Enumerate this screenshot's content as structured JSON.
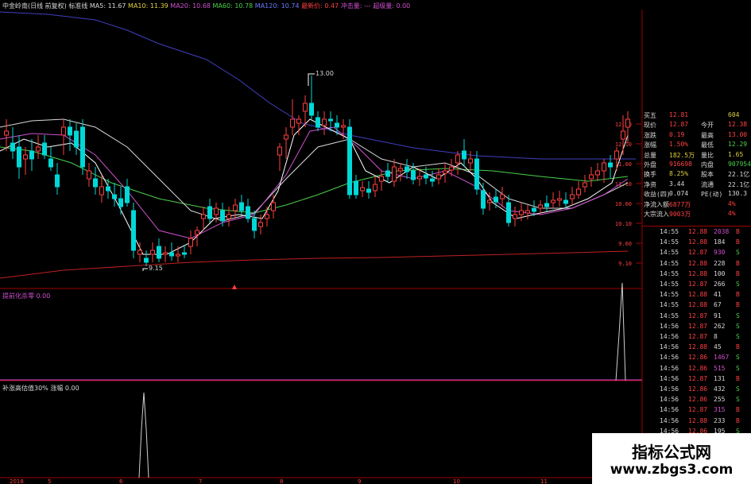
{
  "header": {
    "stock_name": "中金岭南(日线 前复权)",
    "indicator_tag": "标准线",
    "ma5": "MA5: 11.67",
    "ma10": "MA10: 11.39",
    "ma20": "MA20: 10.68",
    "ma60": "MA60: 10.78",
    "ma120": "MA120: 10.74",
    "extra1": "最新价: 0.47",
    "extra2": "冲击量: ---",
    "extra3": "超级量: 0.00"
  },
  "price_labels": {
    "peak": "13.00",
    "low": "9.15"
  },
  "y_axis_ticks": [
    "12.60",
    "12.10",
    "11.60",
    "11.10",
    "10.60",
    "10.10",
    "9.60",
    "9.10"
  ],
  "panel2": {
    "label": "提前化杀零",
    "value": "0.00"
  },
  "panel3": {
    "label": "补涨高估值30%",
    "value_label": "涨幅",
    "value": "0.00"
  },
  "date_axis": [
    "2018",
    "5",
    "6",
    "7",
    "8",
    "9",
    "10",
    "11"
  ],
  "quote": {
    "rows": [
      {
        "l1": "买五",
        "v1": "12.81",
        "l2": "",
        "v2": "604",
        "c1": "#ff4040",
        "c2": "#e0d040"
      },
      {
        "l1": "现价",
        "v1": "12.87",
        "l2": "今开",
        "v2": "12.38",
        "c1": "#ff4040",
        "c2": "#ff4040"
      },
      {
        "l1": "涨跌",
        "v1": "0.19",
        "l2": "最高",
        "v2": "13.00",
        "c1": "#ff4040",
        "c2": "#ff4040"
      },
      {
        "l1": "涨幅",
        "v1": "1.50%",
        "l2": "最低",
        "v2": "12.29",
        "c1": "#ff4040",
        "c2": "#4bd04b"
      },
      {
        "l1": "总量",
        "v1": "182.5万",
        "l2": "量比",
        "v2": "1.65",
        "c1": "#e0d040",
        "c2": "#e0d040"
      },
      {
        "l1": "外盘",
        "v1": "916698",
        "l2": "内盘",
        "v2": "907954",
        "c1": "#ff4040",
        "c2": "#4bd04b"
      },
      {
        "l1": "换手",
        "v1": "8.25%",
        "l2": "股本",
        "v2": "22.1亿",
        "c1": "#e0d040",
        "c2": "#d8d8d8"
      },
      {
        "l1": "净资",
        "v1": "3.44",
        "l2": "流通",
        "v2": "22.1亿",
        "c1": "#d8d8d8",
        "c2": "#d8d8d8"
      },
      {
        "l1": "收益(四)",
        "v1": "0.074",
        "l2": "PE(动)",
        "v2": "130.3",
        "c1": "#d8d8d8",
        "c2": "#d8d8d8"
      },
      {
        "l1": "净流入额",
        "v1": "6877万",
        "l2": "",
        "v2": "4%",
        "c1": "#ff4040",
        "c2": "#ff4040"
      },
      {
        "l1": "大宗流入",
        "v1": "9003万",
        "l2": "",
        "v2": "4%",
        "c1": "#ff4040",
        "c2": "#ff4040"
      }
    ]
  },
  "ticks": [
    {
      "time": "14:55",
      "price": "12.88",
      "vol": "2038",
      "bs": "B",
      "pc": "#ff4040",
      "vc": "#d050d0",
      "bc": "#ff4040"
    },
    {
      "time": "14:55",
      "price": "12.88",
      "vol": "184",
      "bs": "B",
      "pc": "#ff4040",
      "vc": "#d8d8d8",
      "bc": "#ff4040"
    },
    {
      "time": "14:55",
      "price": "12.87",
      "vol": "930",
      "bs": "S",
      "pc": "#ff4040",
      "vc": "#d050d0",
      "bc": "#4bd04b"
    },
    {
      "time": "14:55",
      "price": "12.88",
      "vol": "228",
      "bs": "B",
      "pc": "#ff4040",
      "vc": "#d8d8d8",
      "bc": "#ff4040"
    },
    {
      "time": "14:55",
      "price": "12.88",
      "vol": "100",
      "bs": "B",
      "pc": "#ff4040",
      "vc": "#d8d8d8",
      "bc": "#ff4040"
    },
    {
      "time": "14:55",
      "price": "12.87",
      "vol": "266",
      "bs": "S",
      "pc": "#ff4040",
      "vc": "#d8d8d8",
      "bc": "#4bd04b"
    },
    {
      "time": "14:55",
      "price": "12.88",
      "vol": "41",
      "bs": "B",
      "pc": "#ff4040",
      "vc": "#d8d8d8",
      "bc": "#ff4040"
    },
    {
      "time": "14:55",
      "price": "12.88",
      "vol": "67",
      "bs": "B",
      "pc": "#ff4040",
      "vc": "#d8d8d8",
      "bc": "#ff4040"
    },
    {
      "time": "14:55",
      "price": "12.87",
      "vol": "91",
      "bs": "S",
      "pc": "#ff4040",
      "vc": "#d8d8d8",
      "bc": "#4bd04b"
    },
    {
      "time": "14:56",
      "price": "12.87",
      "vol": "262",
      "bs": "S",
      "pc": "#ff4040",
      "vc": "#d8d8d8",
      "bc": "#4bd04b"
    },
    {
      "time": "14:56",
      "price": "12.87",
      "vol": "8",
      "bs": "S",
      "pc": "#ff4040",
      "vc": "#d8d8d8",
      "bc": "#4bd04b"
    },
    {
      "time": "14:56",
      "price": "12.88",
      "vol": "45",
      "bs": "B",
      "pc": "#ff4040",
      "vc": "#d8d8d8",
      "bc": "#ff4040"
    },
    {
      "time": "14:56",
      "price": "12.86",
      "vol": "1467",
      "bs": "S",
      "pc": "#ff4040",
      "vc": "#d050d0",
      "bc": "#4bd04b"
    },
    {
      "time": "14:56",
      "price": "12.86",
      "vol": "515",
      "bs": "S",
      "pc": "#ff4040",
      "vc": "#d050d0",
      "bc": "#4bd04b"
    },
    {
      "time": "14:56",
      "price": "12.87",
      "vol": "131",
      "bs": "B",
      "pc": "#ff4040",
      "vc": "#d8d8d8",
      "bc": "#ff4040"
    },
    {
      "time": "14:56",
      "price": "12.86",
      "vol": "432",
      "bs": "S",
      "pc": "#ff4040",
      "vc": "#d8d8d8",
      "bc": "#4bd04b"
    },
    {
      "time": "14:56",
      "price": "12.86",
      "vol": "255",
      "bs": "S",
      "pc": "#ff4040",
      "vc": "#d8d8d8",
      "bc": "#4bd04b"
    },
    {
      "time": "14:56",
      "price": "12.87",
      "vol": "315",
      "bs": "B",
      "pc": "#ff4040",
      "vc": "#d050d0",
      "bc": "#ff4040"
    },
    {
      "time": "14:56",
      "price": "12.88",
      "vol": "233",
      "bs": "B",
      "pc": "#ff4040",
      "vc": "#d8d8d8",
      "bc": "#ff4040"
    },
    {
      "time": "14:56",
      "price": "12.86",
      "vol": "195",
      "bs": "S",
      "pc": "#ff4040",
      "vc": "#d8d8d8",
      "bc": "#4bd04b"
    },
    {
      "time": "14:56",
      "price": "12.87",
      "vol": "100",
      "bs": "B",
      "pc": "#ff4040",
      "vc": "#d8d8d8",
      "bc": "#ff4040"
    },
    {
      "time": "14:56",
      "price": "12.88",
      "vol": "308",
      "bs": "B",
      "pc": "#ff4040",
      "vc": "#d8d8d8",
      "bc": "#ff4040"
    },
    {
      "time": "14:56",
      "price": "12.86",
      "vol": "1251",
      "bs": "S",
      "pc": "#ff4040",
      "vc": "#d050d0",
      "bc": "#4bd04b"
    },
    {
      "time": "14:56",
      "price": "12.86",
      "vol": "1",
      "bs": "S",
      "pc": "#ff4040",
      "vc": "#d8d8d8",
      "bc": "#4bd04b"
    }
  ],
  "watermark": {
    "title": "指标公式网",
    "url": "www.zbgs3.com"
  },
  "colors": {
    "up": "#ff4040",
    "down": "#00d8d8",
    "ma5": "#ffffff",
    "ma10": "#e0e0e0",
    "ma20": "#d050d0",
    "ma60": "#4bd04b",
    "ma120": "#4040c0",
    "long_ma": "#c02020",
    "axis": "#a00000"
  }
}
